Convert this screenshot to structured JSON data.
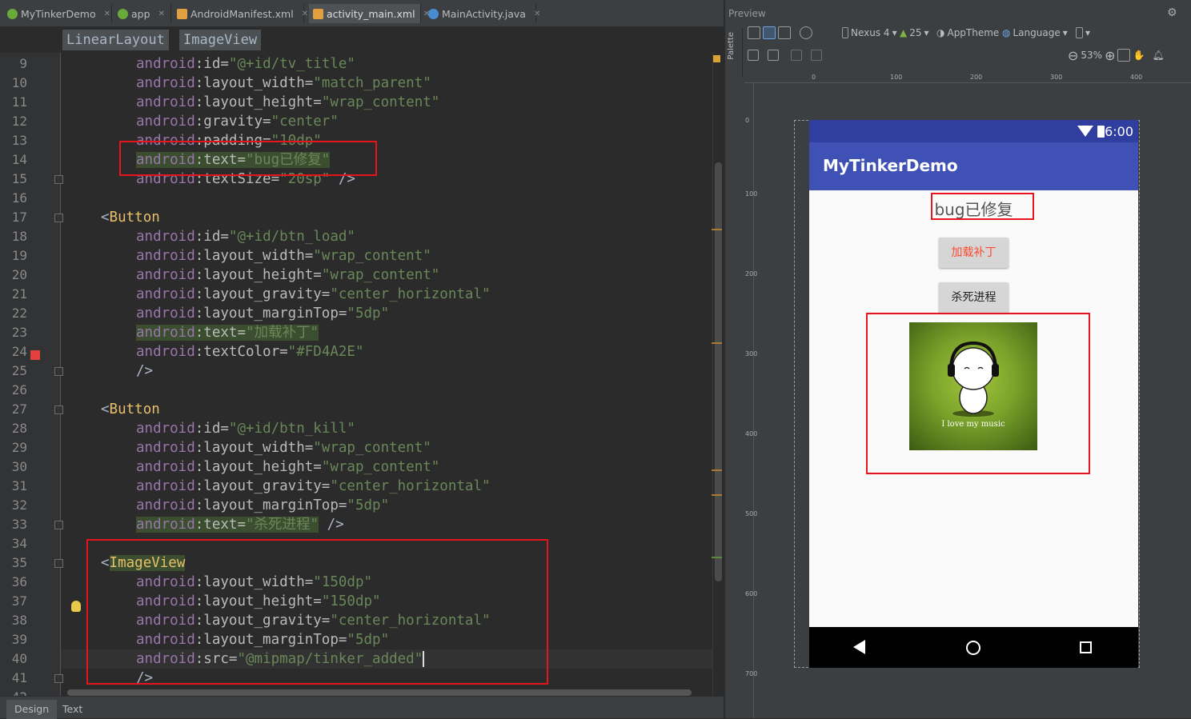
{
  "editor_tabs": [
    {
      "label": "MyTinkerDemo",
      "icon": "android-module-icon",
      "color": "#6aaa3a"
    },
    {
      "label": "app",
      "icon": "android-module-icon",
      "color": "#6aaa3a"
    },
    {
      "label": "AndroidManifest.xml",
      "icon": "xml-file-icon",
      "color": "#e0a040"
    },
    {
      "label": "activity_main.xml",
      "icon": "xml-file-icon",
      "color": "#e0a040"
    },
    {
      "label": "MainActivity.java",
      "icon": "java-class-icon",
      "color": "#4a8cd0"
    }
  ],
  "breadcrumb": [
    "LinearLayout",
    "ImageView"
  ],
  "line_numbers": [
    "9",
    "10",
    "11",
    "12",
    "13",
    "14",
    "15",
    "16",
    "17",
    "18",
    "19",
    "20",
    "21",
    "22",
    "23",
    "24",
    "25",
    "26",
    "27",
    "28",
    "29",
    "30",
    "31",
    "32",
    "33",
    "34",
    "35",
    "36",
    "37",
    "38",
    "39",
    "40",
    "41",
    "42"
  ],
  "code": {
    "l9": {
      "ns": "android",
      "attr": ":id=",
      "val": "\"@+id/tv_title\""
    },
    "l10": {
      "ns": "android",
      "attr": ":layout_width=",
      "val": "\"match_parent\""
    },
    "l11": {
      "ns": "android",
      "attr": ":layout_height=",
      "val": "\"wrap_content\""
    },
    "l12": {
      "ns": "android",
      "attr": ":gravity=",
      "val": "\"center\""
    },
    "l13": {
      "ns": "android",
      "attr": ":padding=",
      "val": "\"10dp\""
    },
    "l14": {
      "ns": "android",
      "attr": ":text=",
      "val": "\"bug已修复\""
    },
    "l15": {
      "ns": "android",
      "attr": ":textSize=",
      "val": "\"20sp\"",
      "end": " />"
    },
    "l17": {
      "open": "<",
      "tag": "Button"
    },
    "l18": {
      "ns": "android",
      "attr": ":id=",
      "val": "\"@+id/btn_load\""
    },
    "l19": {
      "ns": "android",
      "attr": ":layout_width=",
      "val": "\"wrap_content\""
    },
    "l20": {
      "ns": "android",
      "attr": ":layout_height=",
      "val": "\"wrap_content\""
    },
    "l21": {
      "ns": "android",
      "attr": ":layout_gravity=",
      "val": "\"center_horizontal\""
    },
    "l22": {
      "ns": "android",
      "attr": ":layout_marginTop=",
      "val": "\"5dp\""
    },
    "l23": {
      "ns": "android",
      "attr": ":text=",
      "val": "\"加载补丁\""
    },
    "l24": {
      "ns": "android",
      "attr": ":textColor=",
      "val": "\"#FD4A2E\""
    },
    "l25": {
      "end": "/>"
    },
    "l27": {
      "open": "<",
      "tag": "Button"
    },
    "l28": {
      "ns": "android",
      "attr": ":id=",
      "val": "\"@+id/btn_kill\""
    },
    "l29": {
      "ns": "android",
      "attr": ":layout_width=",
      "val": "\"wrap_content\""
    },
    "l30": {
      "ns": "android",
      "attr": ":layout_height=",
      "val": "\"wrap_content\""
    },
    "l31": {
      "ns": "android",
      "attr": ":layout_gravity=",
      "val": "\"center_horizontal\""
    },
    "l32": {
      "ns": "android",
      "attr": ":layout_marginTop=",
      "val": "\"5dp\""
    },
    "l33": {
      "ns": "android",
      "attr": ":text=",
      "val": "\"杀死进程\"",
      "end": " />"
    },
    "l35": {
      "open": "<",
      "tag": "ImageView"
    },
    "l36": {
      "ns": "android",
      "attr": ":layout_width=",
      "val": "\"150dp\""
    },
    "l37": {
      "ns": "android",
      "attr": ":layout_height=",
      "val": "\"150dp\""
    },
    "l38": {
      "ns": "android",
      "attr": ":layout_gravity=",
      "val": "\"center_horizontal\""
    },
    "l39": {
      "ns": "android",
      "attr": ":layout_marginTop=",
      "val": "\"5dp\""
    },
    "l40": {
      "ns": "android",
      "attr": ":src=",
      "val": "\"@mipmap/tinker_added\""
    },
    "l41": {
      "end": "/>"
    }
  },
  "bottom_tabs": [
    "Design",
    "Text"
  ],
  "preview": {
    "title": "Preview",
    "palette_label": "Palette",
    "device": "Nexus 4",
    "api": "25",
    "theme": "AppTheme",
    "language": "Language",
    "zoom": "53%",
    "ruler_top": [
      "0",
      "100",
      "200",
      "300",
      "400"
    ],
    "ruler_left": [
      "0",
      "100",
      "200",
      "300",
      "400",
      "500",
      "600",
      "700"
    ]
  },
  "app": {
    "status_time": "6:00",
    "title": "MyTinkerDemo",
    "tv_title": "bug已修复",
    "btn_load": "加载补丁",
    "btn_kill": "杀死进程",
    "image_caption": "I love my music",
    "colors": {
      "status": "#303f9f",
      "appbar": "#3f51b5",
      "load_text": "#fd4a2e"
    }
  }
}
